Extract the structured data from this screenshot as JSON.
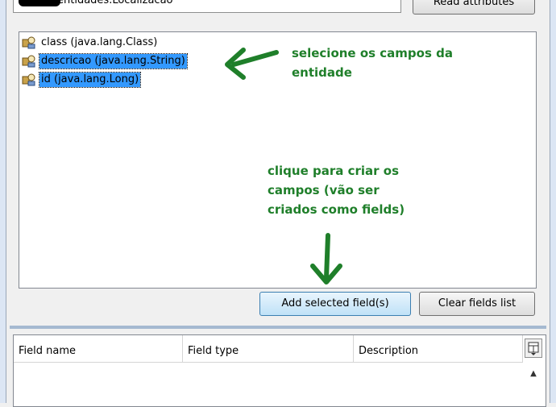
{
  "dialog": {
    "class_field_text": "entidades.Localizacao",
    "read_attributes_label": "Read attributes"
  },
  "attributes": [
    {
      "label": "class (java.lang.Class)",
      "selected": false
    },
    {
      "label": "descricao (java.lang.String)",
      "selected": true
    },
    {
      "label": "id (java.lang.Long)",
      "selected": true
    }
  ],
  "annotations": {
    "select_fields": [
      "selecione os campos da",
      "entidade"
    ],
    "click_to_create": [
      "clique para criar os",
      "campos (vão ser",
      "criados como fields)"
    ],
    "color": "#1f7f2a"
  },
  "buttons": {
    "add_selected": "Add selected field(s)",
    "clear_fields": "Clear fields list"
  },
  "fields_table": {
    "columns": [
      "Field name",
      "Field type",
      "Description"
    ]
  },
  "colors": {
    "selection": "#3399ff",
    "background": "#f0f0f0"
  }
}
